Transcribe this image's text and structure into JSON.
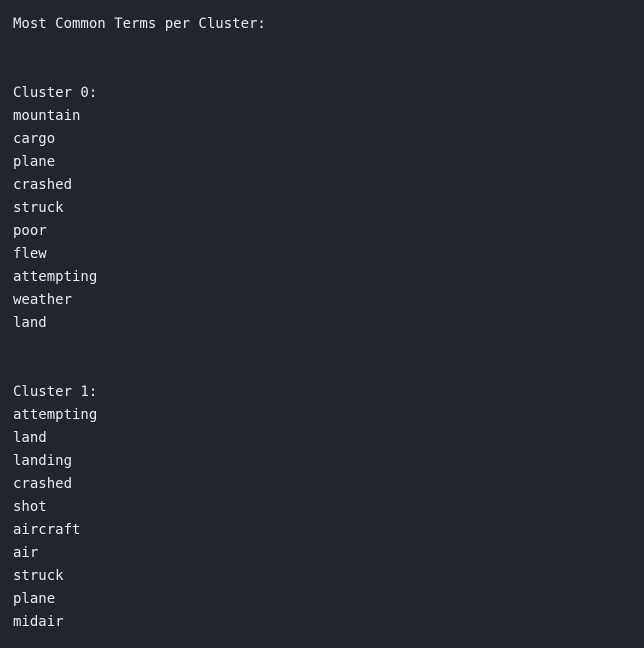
{
  "output": {
    "heading": "Most Common Terms per Cluster:",
    "clusters": [
      {
        "label": "Cluster 0:",
        "terms": [
          "mountain",
          "cargo",
          "plane",
          "crashed",
          "struck",
          "poor",
          "flew",
          "attempting",
          "weather",
          "land"
        ]
      },
      {
        "label": "Cluster 1:",
        "terms": [
          "attempting",
          "land",
          "landing",
          "crashed",
          "shot",
          "aircraft",
          "air",
          "struck",
          "plane",
          "midair"
        ]
      }
    ]
  }
}
